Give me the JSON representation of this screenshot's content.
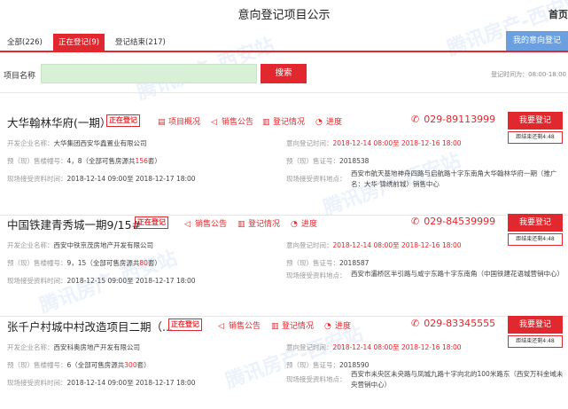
{
  "header": {
    "title": "意向登记项目公示",
    "home": "首页"
  },
  "tabs": [
    {
      "label": "全部(226)"
    },
    {
      "label": "正在登记(9)"
    },
    {
      "label": "登记结束(217)"
    }
  ],
  "my_intent_button": "我的意向登记",
  "search": {
    "label": "项目名称",
    "value": "",
    "button": "搜索",
    "reg_time": "登记时间为：08:00-18:00"
  },
  "watermark": "腾讯房产-西安站",
  "labels": {
    "developer": "开发企业名称：",
    "presale_building": "预（现）售楼幢号：",
    "onsite_time": "现场接受资料时间：",
    "intent_time": "意向登记时间：",
    "presale_cert": "预（现）售证号：",
    "onsite_addr": "现场接受资料地点：",
    "reg_button": "我要登记"
  },
  "projects": [
    {
      "name": "大华翰林华府(一期）",
      "status": "正在登记",
      "actions": [
        "项目概况",
        "销售公告",
        "登记情况",
        "进度"
      ],
      "phone": "029-89113999",
      "countdown": "距结束还剩4:48",
      "developer": "大华集团西安华鑫置业有限公司",
      "building_prefix": "4，8（全部可售房源共",
      "building_count": "156",
      "building_suffix": "套）",
      "onsite_time": "2018-12-14 09:00至 2018-12-17 18:00",
      "intent_time": "2018-12-14 08:00至 2018-12-16 18:00",
      "cert": "2018538",
      "address": "西安市航天基地神舟四路与启航路十字东南角大华翰林华府一期（推广名：大华·锦绣前城）销售中心"
    },
    {
      "name": "中国铁建青秀城一期9/15#",
      "status": "正在登记",
      "actions": [
        "销售公告",
        "登记情况",
        "进度"
      ],
      "phone": "029-84539999",
      "countdown": "距结束还剩4:48",
      "developer": "西安中铁京茂房地产开发有限公司",
      "building_prefix": "9，15（全部可售房源共",
      "building_count": "80",
      "building_suffix": "套）",
      "onsite_time": "2018-12-15 09:00至 2018-12-17 18:00",
      "intent_time": "2018-12-14 08:00至 2018-12-16 18:00",
      "cert": "2018587",
      "address": "西安市灞桥区半引路与咸宁东路十字东南角（中国铁建花语城营销中心）"
    },
    {
      "name": "张千户村城中村改造项目二期（...",
      "status": "正在登记",
      "actions": [
        "销售公告",
        "登记情况",
        "进度"
      ],
      "phone": "029-83345555",
      "countdown": "距结束还剩4:48",
      "developer": "西安科奥房地产开发有限公司",
      "building_prefix": "6（全部可售房源共",
      "building_count": "300",
      "building_suffix": "套）",
      "onsite_time": "2018-12-14 09:00至 2018-12-17 18:00",
      "intent_time": "2018-12-14 08:00至 2018-12-16 18:00",
      "cert": "2018590",
      "address": "西安市未央区未央路与凤城九路十字向北的100米路东（西安万科金域未央营销中心）"
    }
  ]
}
